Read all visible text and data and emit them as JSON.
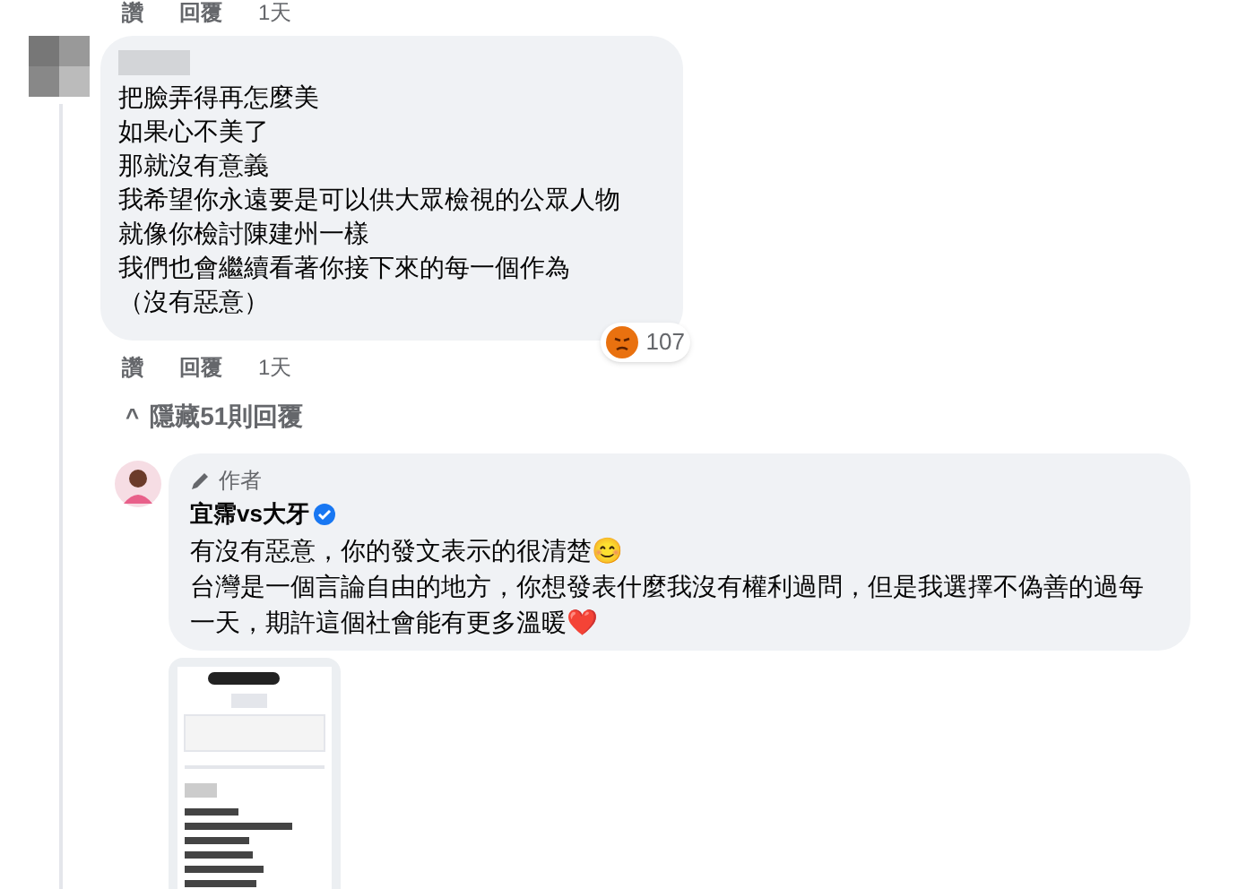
{
  "top_actions": {
    "like": "讚",
    "reply": "回覆",
    "time": "1天"
  },
  "comment": {
    "lines": [
      "把臉弄得再怎麼美",
      "如果心不美了",
      "那就沒有意義",
      "我希望你永遠要是可以供大眾檢視的公眾人物",
      "就像你檢討陳建州一樣",
      "我們也會繼續看著你接下來的每一個作為",
      "（沒有惡意）"
    ],
    "reaction_count": "107",
    "actions": {
      "like": "讚",
      "reply": "回覆",
      "time": "1天"
    }
  },
  "hide_replies": {
    "icon": "^",
    "label": "隱藏51則回覆"
  },
  "reply": {
    "badge": "作者",
    "name": "宜霈vs大牙",
    "verified": true,
    "lines": [
      "有沒有惡意，你的發文表示的很清楚😊",
      "台灣是一個言論自由的地方，你想發表什麼我沒有權利過問，但是我選擇不偽善的過每一天，期許這個社會能有更多溫暖❤️"
    ]
  }
}
